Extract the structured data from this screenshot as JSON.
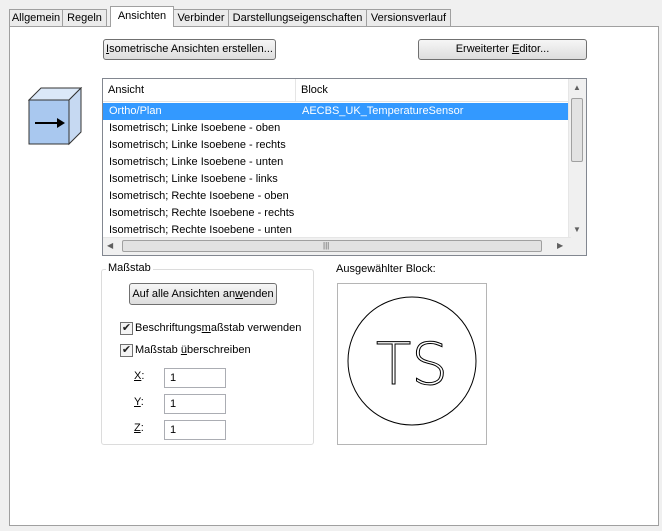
{
  "tabs": [
    "Allgemein",
    "Regeln",
    "Ansichten",
    "Verbinder",
    "Darstellungseigenschaften",
    "Versionsverlauf"
  ],
  "active_tab": "Ansichten",
  "buttons": {
    "isometric_first": "I",
    "isometric_rest": "sometrische Ansichten erstellen...",
    "editor_pre": "Erweiterter ",
    "editor_u": "E",
    "editor_post": "ditor...",
    "apply_pre": "Auf alle Ansichten an",
    "apply_u": "w",
    "apply_post": "enden"
  },
  "view_list": {
    "columns": [
      "Ansicht",
      "Block"
    ],
    "rows": [
      {
        "ansicht": "Ortho/Plan",
        "block": "AECBS_UK_TemperatureSensor",
        "selected": true
      },
      {
        "ansicht": "Isometrisch; Linke Isoebene - oben",
        "block": ""
      },
      {
        "ansicht": "Isometrisch; Linke Isoebene - rechts",
        "block": ""
      },
      {
        "ansicht": "Isometrisch; Linke Isoebene - unten",
        "block": ""
      },
      {
        "ansicht": "Isometrisch; Linke Isoebene - links",
        "block": ""
      },
      {
        "ansicht": "Isometrisch; Rechte Isoebene - oben",
        "block": ""
      },
      {
        "ansicht": "Isometrisch; Rechte Isoebene - rechts",
        "block": ""
      },
      {
        "ansicht": "Isometrisch; Rechte Isoebene - unten",
        "block": ""
      }
    ]
  },
  "scale": {
    "group_title": "Maßstab",
    "annotation_pre": "Beschriftungs",
    "annotation_u": "m",
    "annotation_post": "aßstab verwenden",
    "annotation_checked": true,
    "override_pre": "Maßstab ",
    "override_u": "ü",
    "override_post": "berschreiben",
    "override_checked": true,
    "x_label": "X",
    "x_value": "1",
    "y_label": "Y",
    "y_value": "1",
    "z_label": "Z",
    "z_value": "1"
  },
  "selected_block": {
    "title": "Ausgewählter Block:",
    "preview_text": "TS"
  },
  "colors": {
    "selection": "#3399ff",
    "cube_fill": "#a9c8ef"
  },
  "icons": [
    "view-direction-cube-icon",
    "checkbox-checked-icon",
    "scroll-arrow-icon"
  ]
}
